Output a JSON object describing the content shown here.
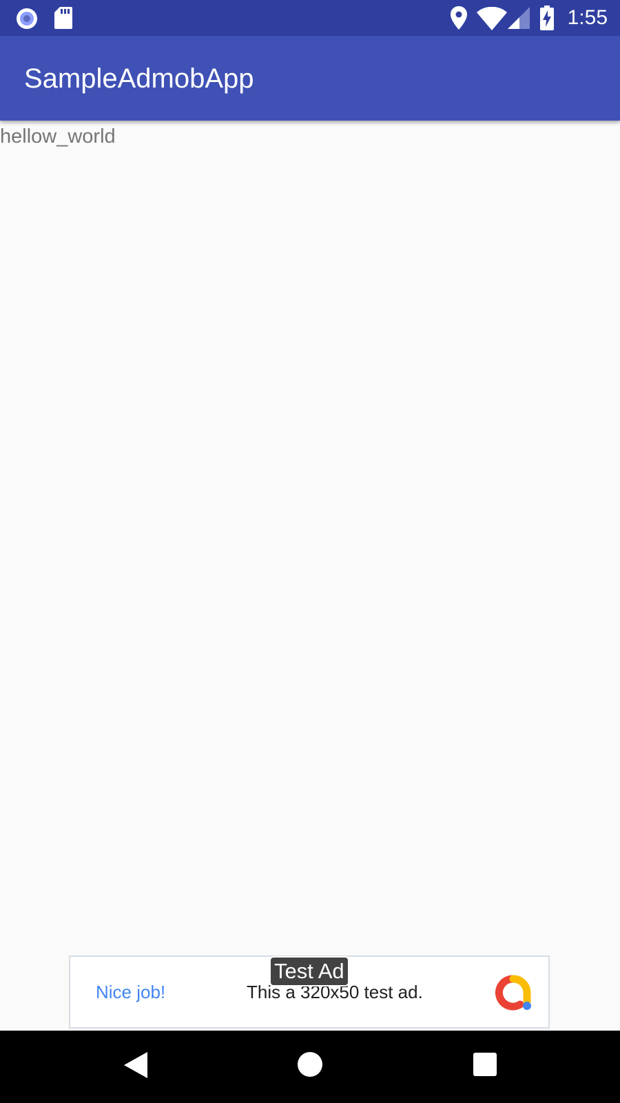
{
  "status_bar": {
    "time": "1:55",
    "icons": [
      "record-icon",
      "sd-card-icon",
      "location-icon",
      "wifi-icon",
      "signal-icon",
      "battery-charging-icon"
    ]
  },
  "app_bar": {
    "title": "SampleAdmobApp"
  },
  "content": {
    "text": "hellow_world"
  },
  "ad": {
    "badge": "Test Ad",
    "nice": "Nice job!",
    "message": "This a 320x50 test ad.",
    "logo_icon": "admob-logo-icon",
    "colors": {
      "nice": "#4285f4",
      "logo_red": "#ea4335",
      "logo_yellow": "#fbbc04",
      "logo_blue": "#4285f4"
    }
  },
  "nav_bar": {
    "icons": [
      "back-icon",
      "home-icon",
      "recents-icon"
    ]
  },
  "colors": {
    "status_bar": "#303f9f",
    "app_bar": "#3f51b5",
    "background": "#fafafa"
  }
}
